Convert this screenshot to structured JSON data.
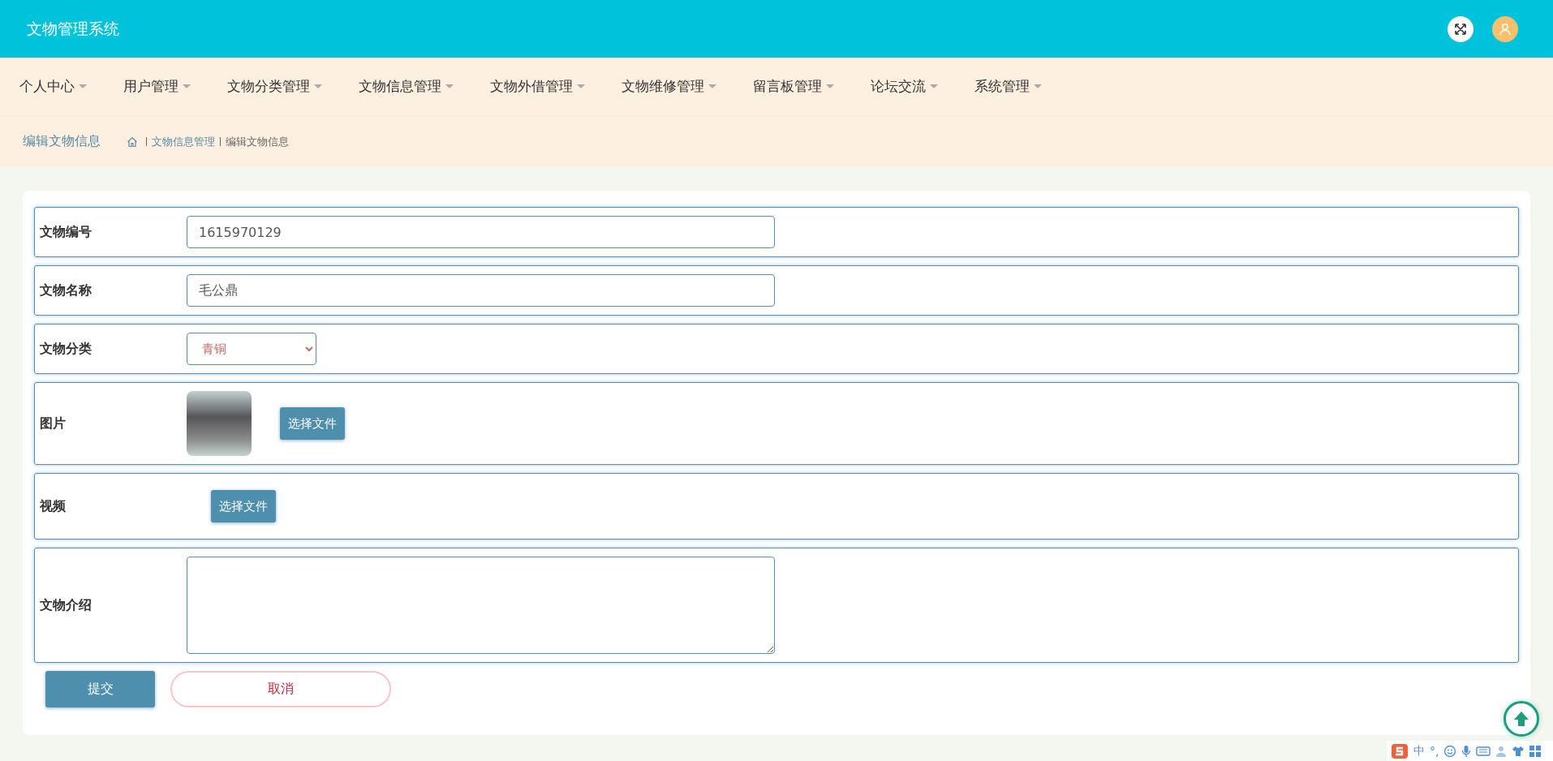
{
  "header": {
    "title": "文物管理系统"
  },
  "menu": [
    {
      "label": "个人中心"
    },
    {
      "label": "用户管理"
    },
    {
      "label": "文物分类管理"
    },
    {
      "label": "文物信息管理"
    },
    {
      "label": "文物外借管理"
    },
    {
      "label": "文物维修管理"
    },
    {
      "label": "留言板管理"
    },
    {
      "label": "论坛交流"
    },
    {
      "label": "系统管理"
    }
  ],
  "breadcrumb": {
    "title": "编辑文物信息",
    "items": [
      "文物信息管理",
      "编辑文物信息"
    ]
  },
  "form": {
    "fields": [
      {
        "kind": "text",
        "label": "文物编号",
        "value": "1615970129"
      },
      {
        "kind": "text",
        "label": "文物名称",
        "value": "毛公鼎"
      },
      {
        "kind": "select",
        "label": "文物分类",
        "value": "青铜"
      },
      {
        "kind": "image",
        "label": "图片",
        "button": "选择文件"
      },
      {
        "kind": "file",
        "label": "视频",
        "button": "选择文件"
      },
      {
        "kind": "textarea",
        "label": "文物介绍"
      }
    ],
    "submit": "提交",
    "cancel": "取消"
  },
  "ime_toolbar": {
    "mode": "中",
    "punctuation": "°,"
  }
}
